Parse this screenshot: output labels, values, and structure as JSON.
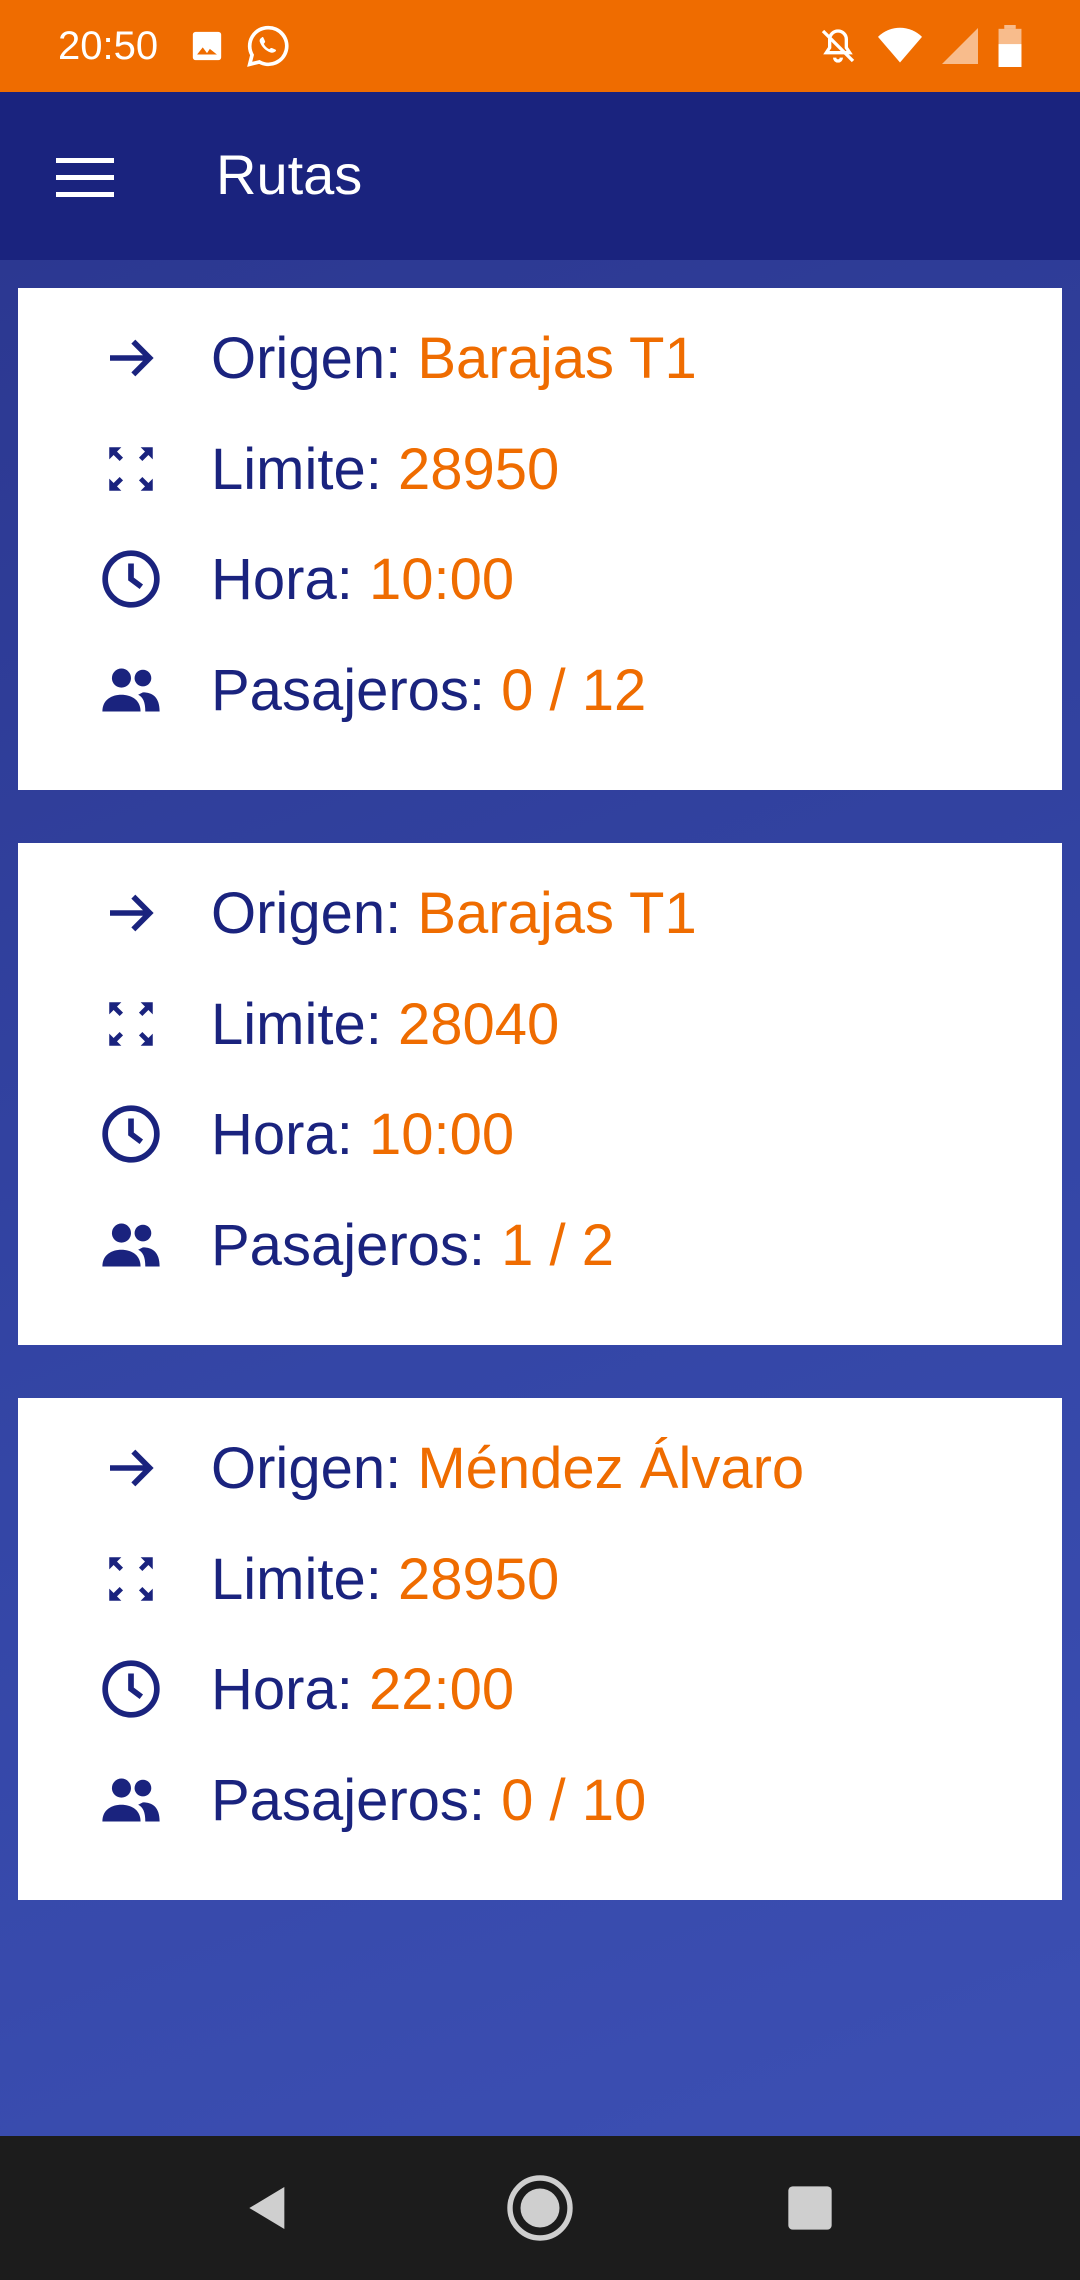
{
  "status_bar": {
    "time": "20:50",
    "left_icons": [
      "image-icon",
      "whatsapp-icon"
    ],
    "right_icons": [
      "notifications-off-icon",
      "wifi-icon",
      "signal-icon",
      "battery-icon"
    ]
  },
  "app_bar": {
    "title": "Rutas",
    "menu_icon": "menu-icon"
  },
  "routes": [
    {
      "origin_label": "Origen:",
      "origin": "Barajas T1",
      "limit_label": "Limite:",
      "limit": "28950",
      "time_label": "Hora:",
      "time": "10:00",
      "passengers_label": "Pasajeros:",
      "passengers": "0 / 12"
    },
    {
      "origin_label": "Origen:",
      "origin": "Barajas T1",
      "limit_label": "Limite:",
      "limit": "28040",
      "time_label": "Hora:",
      "time": "10:00",
      "passengers_label": "Pasajeros:",
      "passengers": "1 / 2"
    },
    {
      "origin_label": "Origen:",
      "origin": "Méndez Álvaro",
      "limit_label": "Limite:",
      "limit": "28950",
      "time_label": "Hora:",
      "time": "22:00",
      "passengers_label": "Pasajeros:",
      "passengers": "0 / 10"
    }
  ],
  "nav_bar": {
    "buttons": [
      "back-icon",
      "home-icon",
      "recents-icon"
    ]
  },
  "colors": {
    "status_bar": "#ef6c00",
    "app_bar": "#1a237e",
    "accent": "#ef6c00",
    "label": "#1a237e",
    "background": "#3446a6"
  }
}
